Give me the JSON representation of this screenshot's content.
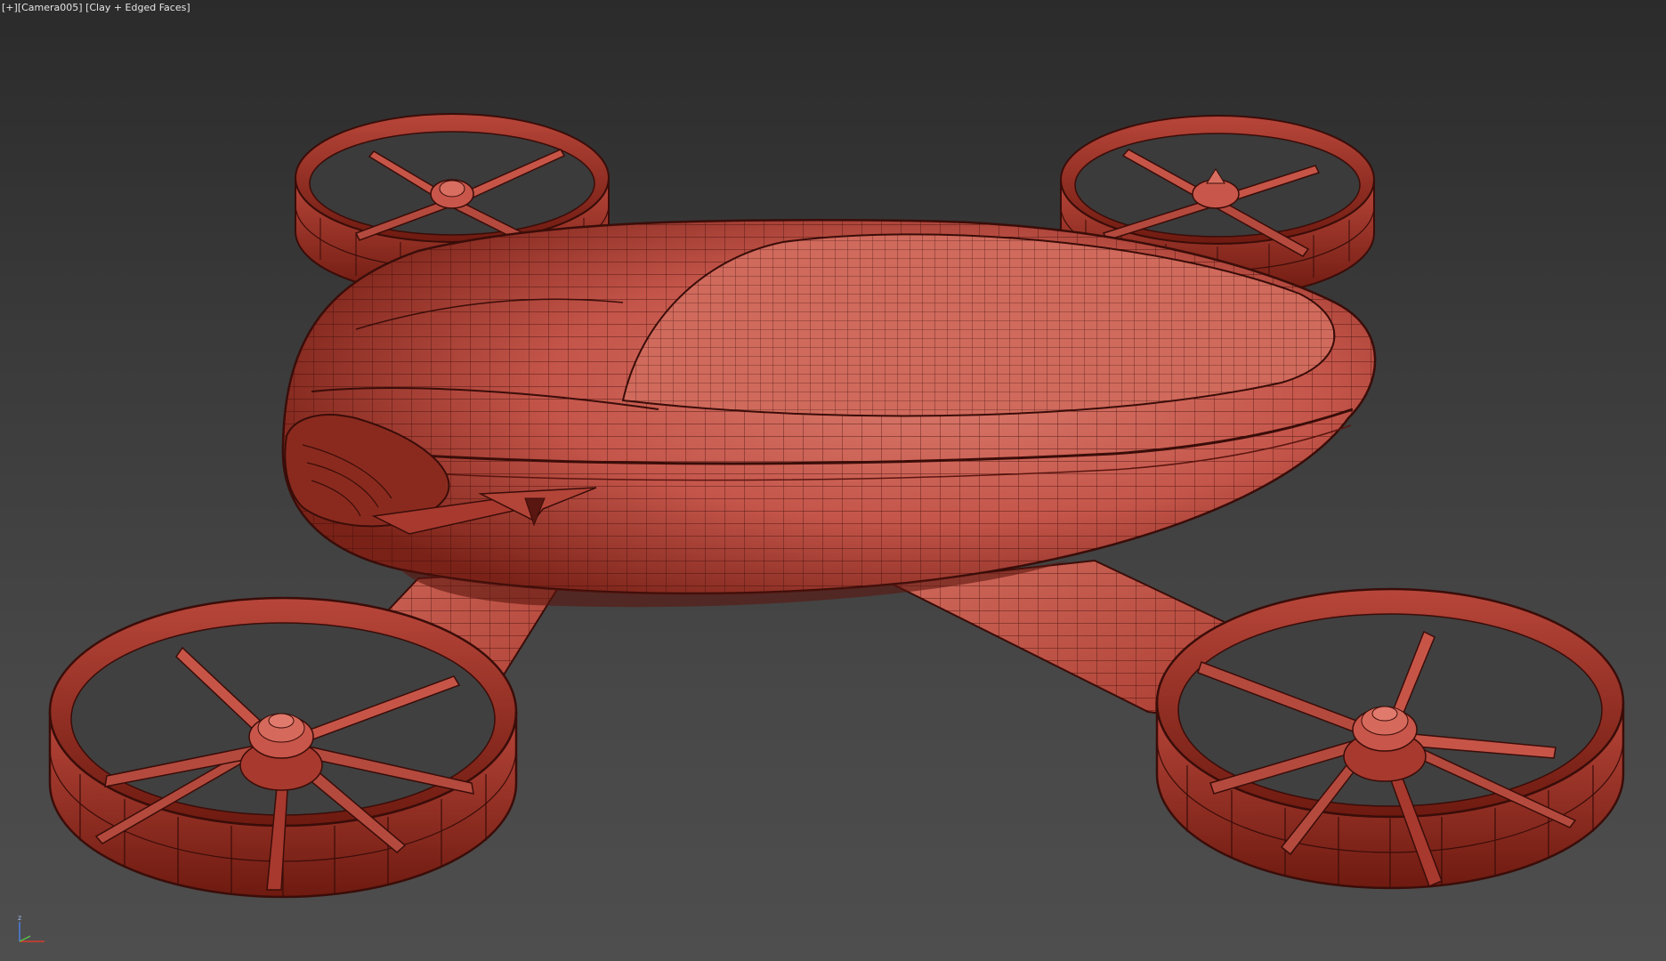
{
  "viewport": {
    "label_plus": "[+]",
    "label_camera": "[Camera005]",
    "label_mode": "[Clay + Edged Faces]",
    "background_top": "#2b2b2b",
    "background_bottom": "#4e4e4e"
  },
  "model": {
    "shade_color": "#c8564a",
    "wire_color": "#3a0d09",
    "dark_color": "#7a2016"
  },
  "axis_gizmo": {
    "z_label": "z",
    "x_color": "#d83a2a",
    "z_color": "#4a7ee0",
    "y_color": "#5dbf4a"
  }
}
